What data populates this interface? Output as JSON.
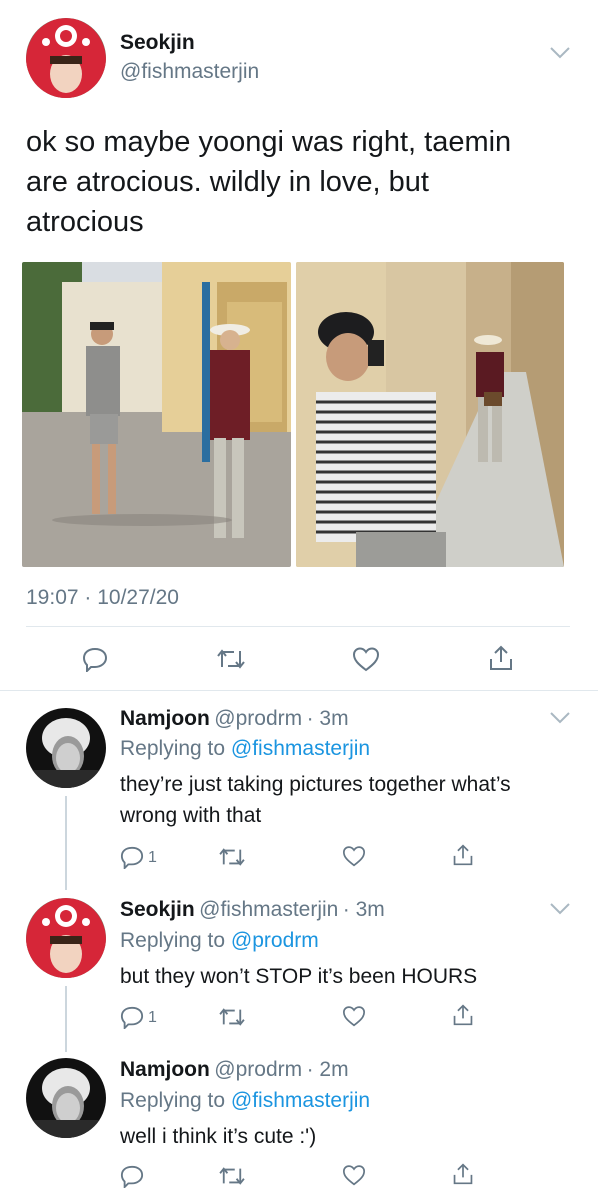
{
  "main_tweet": {
    "name": "Seokjin",
    "handle": "@fishmasterjin",
    "text_lines": [
      "ok so maybe yoongi was right, taemin",
      "are atrocious. wildly in love, but",
      "atrocious"
    ],
    "timestamp": "19:07 · 10/27/20"
  },
  "replies": [
    {
      "name": "Namjoon",
      "handle": "@prodrm",
      "time": "· 3m",
      "replying_prefix": "Replying to",
      "replying_to": "@fishmasterjin",
      "text_lines": [
        "they’re just taking pictures together what’s",
        "wrong with that"
      ],
      "reply_count": "1"
    },
    {
      "name": "Seokjin",
      "handle": "@fishmasterjin",
      "time": "· 3m",
      "replying_prefix": "Replying to",
      "replying_to": "@prodrm",
      "text_lines": [
        "but they won’t STOP it’s been HOURS"
      ],
      "reply_count": "1"
    },
    {
      "name": "Namjoon",
      "handle": "@prodrm",
      "time": "· 2m",
      "replying_prefix": "Replying to",
      "replying_to": "@fishmasterjin",
      "text_lines": [
        "well i think it’s cute :')"
      ],
      "reply_count": ""
    }
  ],
  "icons": {
    "reply": "reply-icon",
    "retweet": "retweet-icon",
    "like": "heart-icon",
    "share": "share-icon",
    "menu": "chevron-down-icon"
  },
  "colors": {
    "link": "#1b95e0",
    "secondary": "#657786",
    "divider": "#e1e8ed"
  }
}
